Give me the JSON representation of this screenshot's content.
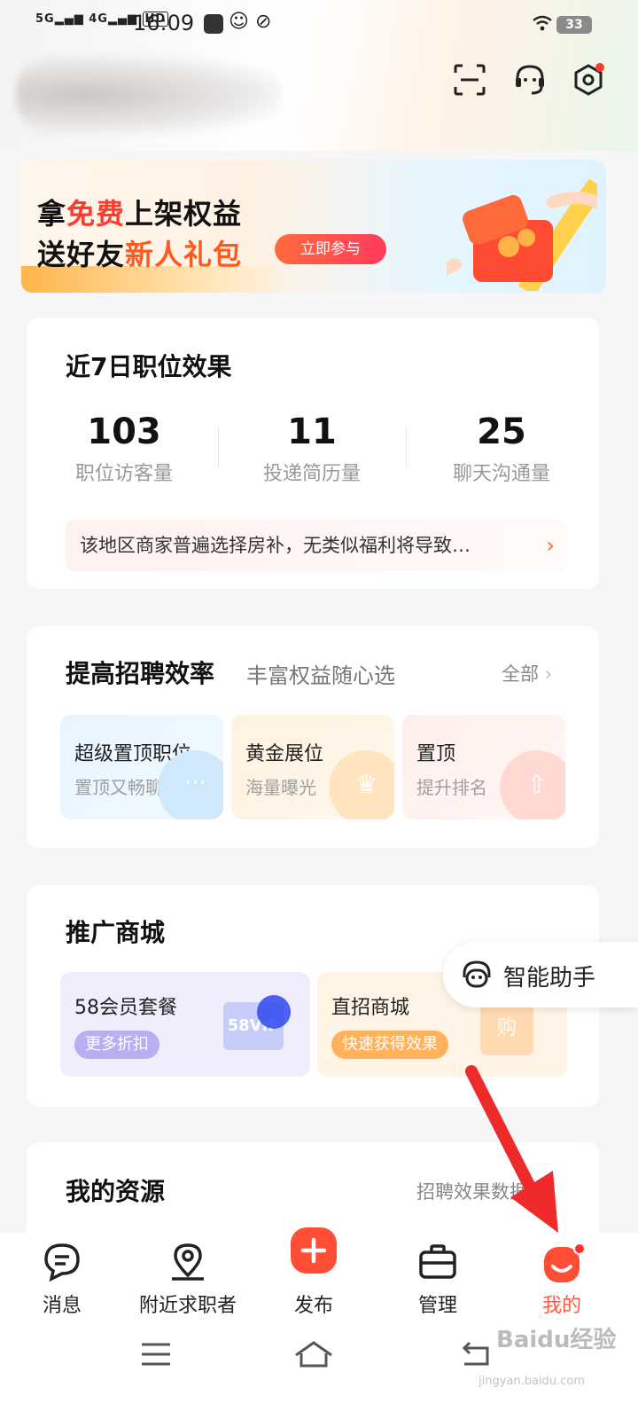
{
  "status_bar": {
    "signal1": "5G",
    "signal2": "4G",
    "hd": "HD",
    "time": "16:09",
    "battery": "33"
  },
  "header": {
    "icons": [
      "scan-icon",
      "customer-service-icon",
      "settings-icon"
    ]
  },
  "banner": {
    "line1_prefix": "拿",
    "line1_highlight": "免费",
    "line1_suffix": "上架权益",
    "line2_prefix": "送好友",
    "line2_highlight": "新人礼包",
    "button": "立即参与"
  },
  "job_effect": {
    "title": "近7日职位效果",
    "stats": [
      {
        "value": "103",
        "label": "职位访客量"
      },
      {
        "value": "11",
        "label": "投递简历量"
      },
      {
        "value": "25",
        "label": "聊天沟通量"
      }
    ],
    "tip": "该地区商家普遍选择房补，无类似福利将导致…"
  },
  "efficiency": {
    "title": "提高招聘效率",
    "subtitle": "丰富权益随心选",
    "more": "全部",
    "tiles": [
      {
        "title": "超级置顶职位",
        "sub": "置顶又畅聊"
      },
      {
        "title": "黄金展位",
        "sub": "海量曝光"
      },
      {
        "title": "置顶",
        "sub": "提升排名"
      }
    ]
  },
  "mall": {
    "title": "推广商城",
    "items": [
      {
        "title": "58会员套餐",
        "tag": "更多折扣",
        "badge": "58VIP"
      },
      {
        "title": "直招商城",
        "tag": "快速获得效果",
        "badge": "购"
      }
    ]
  },
  "assistant": {
    "label": "智能助手"
  },
  "resources": {
    "title": "我的资源",
    "more": "招聘效果数据"
  },
  "bottom_nav": [
    {
      "label": "消息",
      "active": false
    },
    {
      "label": "附近求职者",
      "active": false
    },
    {
      "label": "发布",
      "active": false
    },
    {
      "label": "管理",
      "active": false
    },
    {
      "label": "我的",
      "active": true
    }
  ],
  "colors": {
    "accent": "#ff5a3c",
    "active_nav": "#ff5a3c",
    "arrow": "#ee2a2a"
  },
  "watermark": {
    "brand": "Baidu经验",
    "url": "jingyan.baidu.com"
  }
}
